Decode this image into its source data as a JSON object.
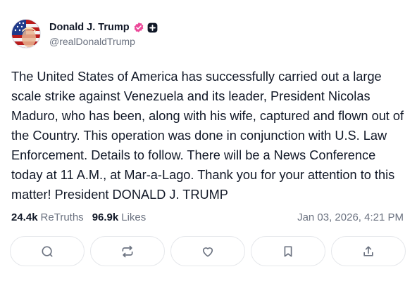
{
  "author": {
    "display_name": "Donald J. Trump",
    "handle": "@realDonaldTrump",
    "verified_color": "#ec4899"
  },
  "post": {
    "text": "The United States of America has successfully carried out a large scale strike against Venezuela and its leader, President Nicolas Maduro, who has been, along with his wife, captured and flown out of the Country. This operation was done in conjunction with U.S. Law Enforcement. Details to follow. There will be a News Conference today at 11 A.M., at Mar-a-Lago. Thank you for your attention to this matter! President DONALD J. TRUMP",
    "retruths_count": "24.4k",
    "retruths_label": "ReTruths",
    "likes_count": "96.9k",
    "likes_label": "Likes",
    "timestamp": "Jan 03, 2026, 4:21 PM"
  },
  "actions": [
    {
      "icon": "reply-icon"
    },
    {
      "icon": "retruth-icon"
    },
    {
      "icon": "like-icon"
    },
    {
      "icon": "bookmark-icon"
    },
    {
      "icon": "share-icon"
    }
  ]
}
